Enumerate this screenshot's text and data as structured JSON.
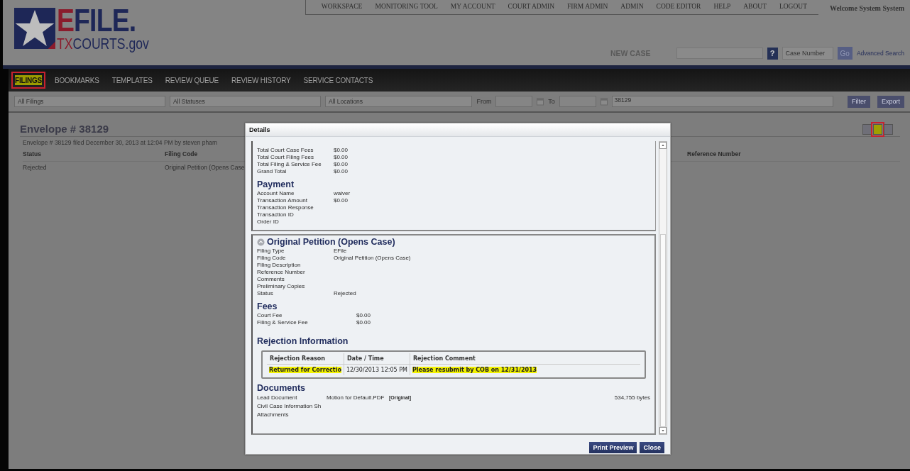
{
  "logo": {
    "word": [
      {
        "text": "E",
        "kind": "accent"
      },
      {
        "text": "FILE.",
        "kind": "plain"
      }
    ],
    "domain": [
      {
        "text": "TX",
        "kind": "accent"
      },
      {
        "text": "COURTS.gov",
        "kind": "plain"
      }
    ]
  },
  "top_nav": [
    "WORKSPACE",
    "MONITORING TOOL",
    "MY ACCOUNT",
    "COURT ADMIN",
    "FIRM ADMIN",
    "ADMIN",
    "CODE EDITOR",
    "HELP",
    "ABOUT",
    "LOGOUT"
  ],
  "welcome": "Welcome System System",
  "quick_bar": {
    "new_case_label": "NEW CASE",
    "help_button": "?",
    "case_number_placeholder": "Case Number",
    "go_button": "Go",
    "advanced_search_link": "Advanced Search"
  },
  "tabs": [
    {
      "label": "FILINGS",
      "selected": true,
      "marked": true
    },
    {
      "label": "BOOKMARKS",
      "selected": false,
      "marked": false
    },
    {
      "label": "TEMPLATES",
      "selected": false,
      "marked": false
    },
    {
      "label": "REVIEW QUEUE",
      "selected": false,
      "marked": false
    },
    {
      "label": "REVIEW HISTORY",
      "selected": false,
      "marked": false
    },
    {
      "label": "SERVICE CONTACTS",
      "selected": false,
      "marked": false
    }
  ],
  "filters": {
    "filing_select": "All Filings",
    "status_select": "All Statuses",
    "location_select": "All Locations",
    "from_label": "From",
    "to_label": "To",
    "envelope_field": "38129",
    "filter_button": "Filter",
    "export_button": "Export"
  },
  "envelope": {
    "title": "Envelope # 38129",
    "subtitle": "Envelope # 38129 filed December 30, 2013 at 12:04 PM by steven pham",
    "columns": [
      "Status",
      "Filing Code",
      "Reference Number"
    ],
    "rows": [
      [
        "Rejected",
        "Original Petition (Opens Case"
      ]
    ],
    "view_icons": [
      {
        "selected": false,
        "marked": false
      },
      {
        "selected": true,
        "marked": true
      },
      {
        "selected": false,
        "marked": false
      }
    ]
  },
  "dialog": {
    "title": "Details",
    "totals": [
      {
        "label": "Total Court Case Fees",
        "value": "$0.00"
      },
      {
        "label": "Total Court Filing Fees",
        "value": "$0.00"
      },
      {
        "label": "Total Filing & Service Fee",
        "value": "$0.00"
      },
      {
        "label": "Grand Total",
        "value": "$0.00"
      }
    ],
    "payment_heading": "Payment",
    "payment": [
      {
        "label": "Account Name",
        "value": "waiver"
      },
      {
        "label": "Transaction Amount",
        "value": "$0.00"
      },
      {
        "label": "Transaction Response"
      },
      {
        "label": "Transaction ID"
      },
      {
        "label": "Order ID"
      }
    ],
    "filing_heading": "Original Petition (Opens Case)",
    "filing": [
      {
        "label": "Filing Type",
        "value": "EFile"
      },
      {
        "label": "Filing Code",
        "value": "Original Petition (Opens Case)"
      },
      {
        "label": "Filing Description"
      },
      {
        "label": "Reference Number"
      },
      {
        "label": "Comments"
      },
      {
        "label": "Preliminary Copies"
      },
      {
        "label": "Status",
        "value": "Rejected"
      }
    ],
    "fees_heading": "Fees",
    "fees": [
      {
        "label": "Court Fee",
        "value": "$0.00"
      },
      {
        "label": "Filing & Service Fee",
        "value": "$0.00"
      }
    ],
    "rejection_heading": "Rejection Information",
    "rejection_columns": [
      "Rejection Reason",
      "Date / Time",
      "Rejection Comment"
    ],
    "rejection_rows": [
      [
        {
          "text": "Returned for Correctio",
          "highlighted": true
        },
        {
          "text": "12/30/2013 12:05 PM",
          "highlighted": false
        },
        {
          "text": "Please resubmit by COB on 12/31/2013",
          "highlighted": true
        }
      ]
    ],
    "documents_heading": "Documents",
    "documents": [
      {
        "label": "Lead Document",
        "name": "Motion for Default.PDF",
        "tag": "[Original]",
        "size": "534,755 bytes"
      },
      {
        "label": "Civil Case Information Sh"
      },
      {
        "label": "Attachments"
      }
    ],
    "buttons": [
      "Print Preview",
      "Close"
    ]
  }
}
